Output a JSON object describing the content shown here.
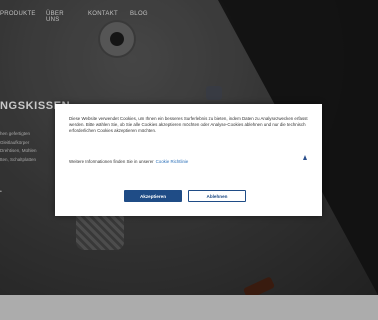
{
  "nav": {
    "items": [
      "PRODUKTE",
      "ÜBER UNS",
      "KONTAKT",
      "BLOG"
    ]
  },
  "hero": {
    "heading": "NGSKISSEN",
    "text_lines": [
      "hen gefertigten",
      "Gleitlaufkörper",
      "Drehtisen, Mühlen",
      "tten, Schaltplatten"
    ],
    "bullet": "•"
  },
  "cookie": {
    "message": "Diese Website verwendet Cookies, um Ihnen ein besseres Surferlebnis zu bieten, indem Daten zu Analysezwecken erfasst werden. Bitte wählen Sie, ob Sie alle Cookies akzeptieren möchten oder Analyse-Cookies ablehnen und nur die technisch erforderlichen Cookies akzeptieren möchten.",
    "more_info_prefix": "Weitere Informationen finden Sie in unserer",
    "more_info_link": "Cookie Richtlinie",
    "accept_label": "Akzeptieren",
    "reject_label": "Ablehnen",
    "toggle_icon": "triangle-up-icon"
  },
  "colors": {
    "accent": "#1f4c86",
    "link": "#2a6fb8",
    "modal_bg": "#ffffff"
  }
}
